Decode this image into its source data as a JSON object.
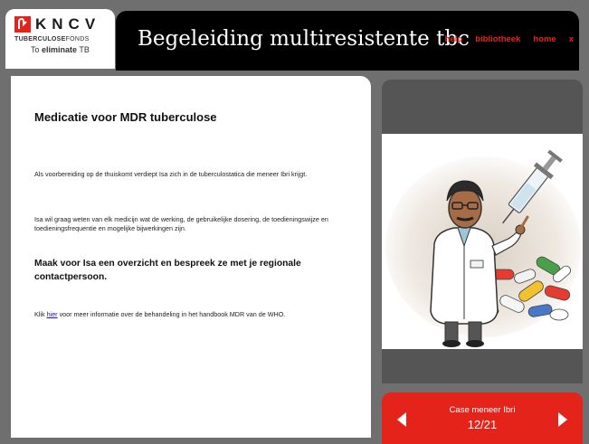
{
  "logo": {
    "letters": "KNCV",
    "subtitle_bold": "TUBERCULOSE",
    "subtitle_rest": "FONDS",
    "tagline_prefix": "To ",
    "tagline_bold": "eliminate",
    "tagline_suffix": " TB"
  },
  "header": {
    "title": "Begeleiding multiresistente tbc",
    "nav": [
      "help",
      "bibliotheek",
      "home",
      "x"
    ]
  },
  "content": {
    "title": "Medicatie voor MDR tuberculose",
    "para1": "Als voorbereiding op de thuiskomt verdiept Isa zich in de tuberculostatica die meneer Ibri krijgt.",
    "para2": "Isa wil graag weten van elk medicijn wat de werking, de gebruikelijke dosering, de toedieningswijze en toedieningsfrequentie en mogelijke bijwerkingen zijn.",
    "task": "Maak voor Isa een overzicht en bespreek ze met je regionale contactpersoon.",
    "link_prefix": "Klik ",
    "link_text": "hier",
    "link_suffix": " voor meer informatie over de behandeling in het handbook MDR van de WHO."
  },
  "case": {
    "label": "Case meneer Ibri",
    "progress": "12/21"
  },
  "colors": {
    "accent": "#e4231b",
    "header_bg": "#000000",
    "panel_dark": "#555555",
    "page_bg": "#6f6f6f"
  }
}
